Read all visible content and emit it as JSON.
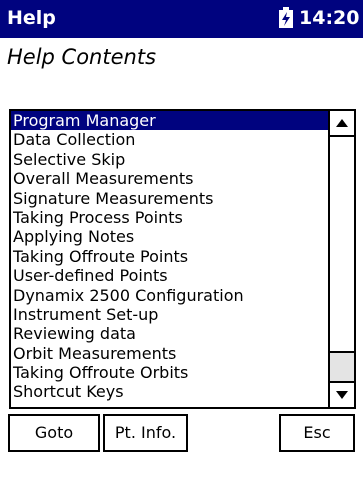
{
  "titlebar": {
    "title": "Help",
    "time": "14:20",
    "battery_icon": "battery-icon"
  },
  "heading": "Help Contents",
  "help_list": {
    "selected_index": 0,
    "items": [
      "Program Manager",
      "Data Collection",
      "Selective Skip",
      "Overall Measurements",
      "Signature Measurements",
      "Taking Process Points",
      "Applying Notes",
      "Taking Offroute Points",
      "User-defined Points",
      "Dynamix 2500 Configuration",
      "Instrument Set-up",
      "Reviewing data",
      "Orbit Measurements",
      "Taking Offroute Orbits",
      "Shortcut Keys"
    ]
  },
  "scrollbar": {
    "up_icon": "up-arrow-icon",
    "down_icon": "down-arrow-icon"
  },
  "softkeys": {
    "goto": "Goto",
    "pt_info": "Pt. Info.",
    "esc": "Esc"
  },
  "colors": {
    "title_bg": "#00037f",
    "selection_bg": "#00037f",
    "scroll_track": "#e4e4e4"
  }
}
